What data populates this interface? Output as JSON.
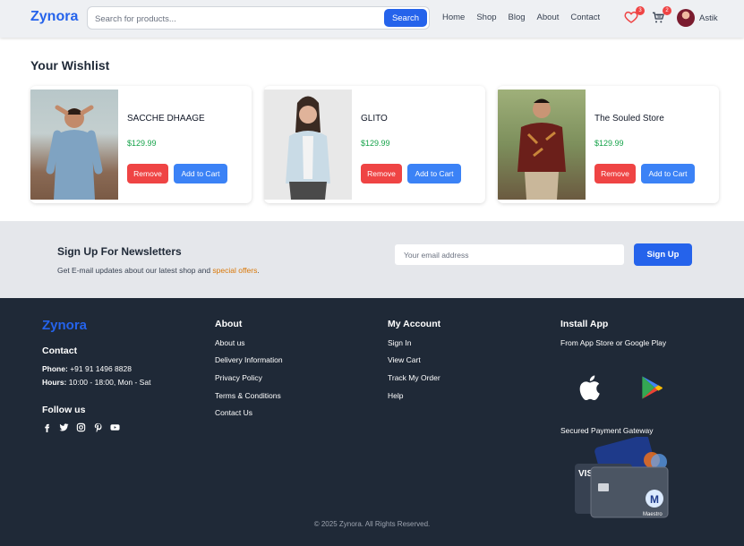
{
  "header": {
    "logo": "Zynora",
    "search_placeholder": "Search for products...",
    "search_button": "Search",
    "nav": [
      "Home",
      "Shop",
      "Blog",
      "About",
      "Contact"
    ],
    "wishlist_count": "3",
    "cart_count": "2",
    "username": "Astik"
  },
  "wishlist": {
    "title": "Your Wishlist",
    "items": [
      {
        "name": "SACCHE DHAAGE",
        "price": "$129.99",
        "remove_label": "Remove",
        "cart_label": "Add to Cart"
      },
      {
        "name": "GLITO",
        "price": "$129.99",
        "remove_label": "Remove",
        "cart_label": "Add to Cart"
      },
      {
        "name": "The Souled Store",
        "price": "$129.99",
        "remove_label": "Remove",
        "cart_label": "Add to Cart"
      }
    ]
  },
  "newsletter": {
    "title": "Sign Up For Newsletters",
    "subtitle_prefix": "Get E-mail updates about our latest shop and ",
    "subtitle_highlight": "special offers",
    "subtitle_suffix": ".",
    "email_placeholder": "Your email address",
    "button": "Sign Up"
  },
  "footer": {
    "logo": "Zynora",
    "contact_heading": "Contact",
    "phone_label": "Phone:",
    "phone": "+91 91 1496 8828",
    "hours_label": "Hours:",
    "hours": "10:00 - 18:00, Mon - Sat",
    "follow_heading": "Follow us",
    "about_heading": "About",
    "about_links": [
      "About us",
      "Delivery Information",
      "Privacy Policy",
      "Terms & Conditions",
      "Contact Us"
    ],
    "account_heading": "My Account",
    "account_links": [
      "Sign In",
      "View Cart",
      "Track My Order",
      "Help"
    ],
    "install_heading": "Install App",
    "install_sub": "From App Store or Google Play",
    "payment_heading": "Secured Payment Gateway",
    "copyright": "© 2025 Zynora. All Rights Reserved."
  },
  "colors": {
    "brand": "#2563eb",
    "danger": "#ef4444",
    "price": "#16a34a",
    "footer_bg": "#1f2937",
    "highlight": "#d97706"
  }
}
